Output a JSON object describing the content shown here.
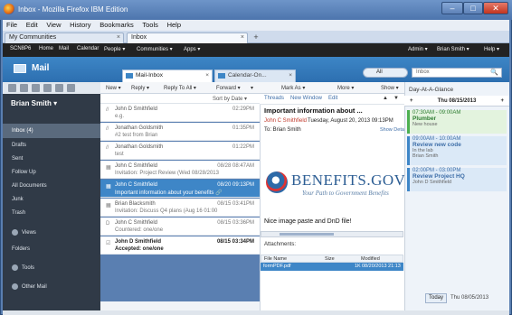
{
  "window": {
    "title": "Inbox - Mozilla Firefox IBM Edition",
    "min": "–",
    "max": "□",
    "close": "✕"
  },
  "menu": [
    "File",
    "Edit",
    "View",
    "History",
    "Bookmarks",
    "Tools",
    "Help"
  ],
  "tabs": [
    {
      "label": "My Communities",
      "close": "×"
    },
    {
      "label": "Inbox",
      "close": "×"
    }
  ],
  "new_tab": "+",
  "topnav": {
    "left": [
      "SCN8P6",
      "Home",
      "Mail",
      "Calendar",
      "People ▾",
      "Communities ▾",
      "Apps ▾"
    ],
    "right": [
      "Admin ▾",
      "Brian Smith ▾",
      "Help ▾"
    ]
  },
  "mail_header": {
    "title": "Mail",
    "subtabs": [
      {
        "label": "Mail-Inbox",
        "close": "×"
      },
      {
        "label": "Calendar-On...",
        "close": "×"
      }
    ],
    "scope": "All",
    "search_placeholder": "Inbox",
    "search_icon": "🔍"
  },
  "sidebar": {
    "user": "Brian Smith ▾",
    "items": [
      {
        "label": "Inbox (4)"
      },
      {
        "label": "Drafts"
      },
      {
        "label": "Sent"
      },
      {
        "label": "Follow Up"
      },
      {
        "label": "All Documents"
      },
      {
        "label": "Junk"
      },
      {
        "label": "Trash"
      },
      {
        "label": "Views"
      },
      {
        "label": "Folders"
      },
      {
        "label": "Tools"
      },
      {
        "label": "Other Mail"
      }
    ]
  },
  "list_toolbar": [
    "New ▾",
    "Reply ▾",
    "Reply To All ▾",
    "Forward ▾",
    "▾",
    "Mark As ▾",
    "More ▾",
    "Show ▾"
  ],
  "sort_label": "Sort by Date ▾",
  "messages": [
    {
      "icon": "//",
      "from": "John D Smithfield",
      "date": "02:29PM",
      "subject": "e.g."
    },
    {
      "icon": "//",
      "from": "Jonathan Goldsmith",
      "date": "01:35PM",
      "subject": "#2 test from Brian"
    },
    {
      "icon": "//",
      "from": "Jonathan Goldsmith",
      "date": "01:22PM",
      "subject": "test"
    },
    {
      "icon": "▦",
      "from": "John C Smithfield",
      "date": "08/28 08:47AM",
      "subject": "Invitation: Project Review (Wed 08/28/2013"
    },
    {
      "icon": "▦",
      "from": "John C Smithfield",
      "date": "08/20 09:13PM",
      "subject": "Important information about your benefits 🔗"
    },
    {
      "icon": "▦",
      "from": "Brian Blacksmith",
      "date": "08/15 03:41PM",
      "subject": "Invitation: Discuss Q4 plans (Aug 16 01:00"
    },
    {
      "icon": "D",
      "from": "John C Smithfield",
      "date": "08/15 03:36PM",
      "subject": "Countered: one/one"
    },
    {
      "icon": "☑",
      "from": "John D Smithfield",
      "date": "08/15 03:34PM",
      "subject": "Accepted: one/one"
    }
  ],
  "preview": {
    "links": [
      "Threads",
      "New Window",
      "Edit"
    ],
    "subject": "Important information about ...",
    "from": "John C Smithfield",
    "date": "Tuesday, August 20, 2013 09:13PM",
    "to": "To:   Brian Smith",
    "show_details": "Show Details",
    "logo_word": "BENEFITS.GOV",
    "logo_tag": "Your Path to Government Benefits",
    "body": "Nice image paste and DnD file!",
    "attachments_label": "Attachments:",
    "att_headers": [
      "File Name",
      "Size",
      "Modified"
    ],
    "att_row": [
      "formPDF.pdf",
      "1K",
      "08/20/2013 21:13"
    ]
  },
  "calendar": {
    "title": "Day-At-A-Glance",
    "date": "Thu 08/15/2013",
    "events": [
      {
        "time": "07:30AM - 09:00AM",
        "name": "Plumber",
        "loc": "New house"
      },
      {
        "time": "09:00AM - 10:00AM",
        "name": "Review new code",
        "loc": "In the lab",
        "who": "Brian Smith"
      },
      {
        "time": "02:00PM - 03:00PM",
        "name": "Review Project HQ",
        "loc": "John D Smithfield"
      }
    ],
    "today": "Today",
    "today_date": "Thu 08/05/2013"
  }
}
